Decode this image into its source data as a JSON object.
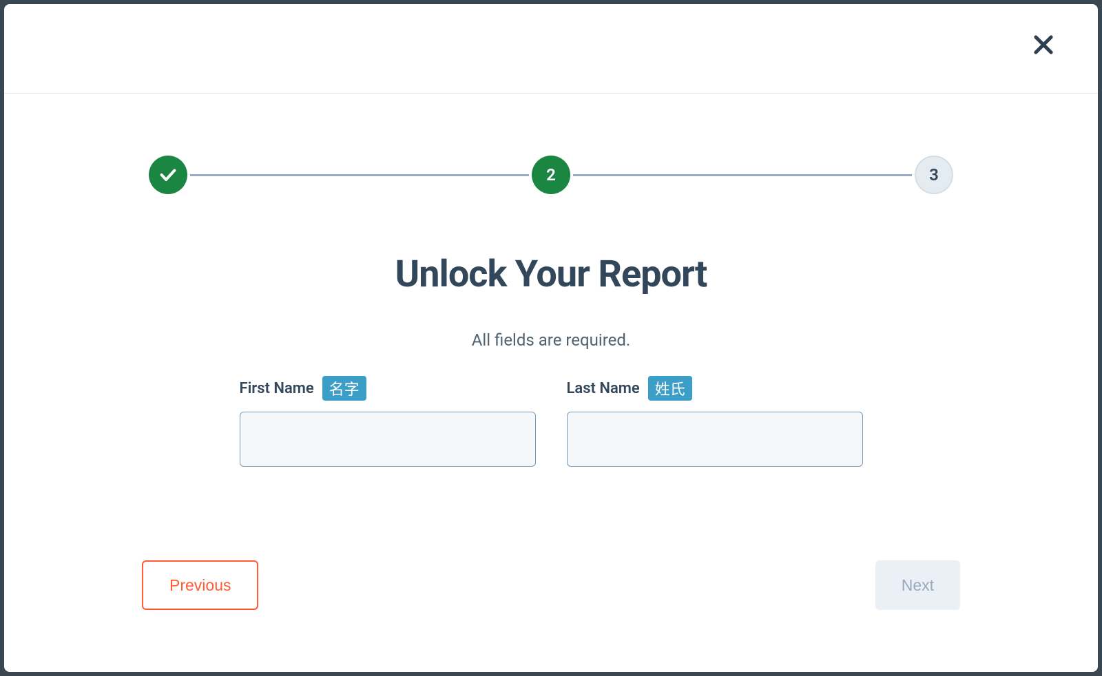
{
  "stepper": {
    "step1": {
      "state": "done"
    },
    "step2": {
      "state": "active",
      "label": "2"
    },
    "step3": {
      "state": "inactive",
      "label": "3"
    }
  },
  "main": {
    "title": "Unlock Your Report",
    "subtitle": "All fields are required."
  },
  "form": {
    "firstName": {
      "label": "First Name",
      "translation": "名字",
      "value": ""
    },
    "lastName": {
      "label": "Last Name",
      "translation": "姓氏",
      "value": ""
    }
  },
  "footer": {
    "previous_label": "Previous",
    "next_label": "Next"
  }
}
